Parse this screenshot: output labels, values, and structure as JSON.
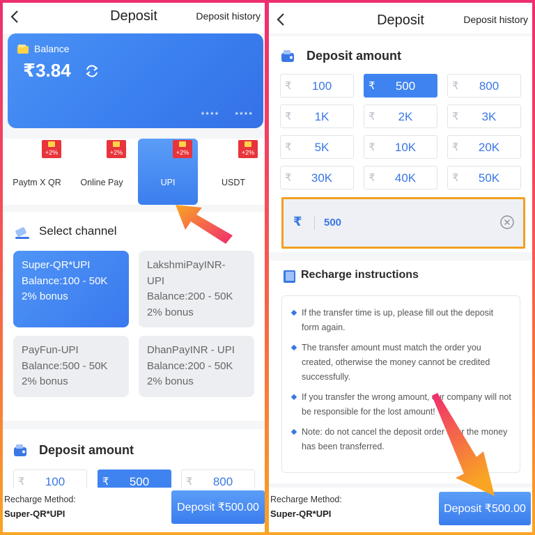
{
  "left": {
    "header": {
      "title": "Deposit",
      "history_link": "Deposit history"
    },
    "balance": {
      "label": "Balance",
      "amount": "₹3.84",
      "card_mask_1": "****",
      "card_mask_2": "****"
    },
    "pay_tabs": [
      {
        "label": "Paytm X QR",
        "bonus": "+2%"
      },
      {
        "label": "Online Pay",
        "bonus": "+2%"
      },
      {
        "label": "UPI",
        "bonus": "+2%",
        "active": true
      },
      {
        "label": "USDT",
        "bonus": "+2%"
      }
    ],
    "select_channel": {
      "title": "Select channel",
      "channels": [
        {
          "line1": "Super-QR*UPI",
          "line2": "Balance:100 - 50K",
          "line3": "2% bonus",
          "active": true
        },
        {
          "line1": "LakshmiPayINR-",
          "line1b": "UPI",
          "line2": "Balance:200 - 50K",
          "line3": "2% bonus"
        },
        {
          "line1": "PayFun-UPI",
          "line2": "Balance:500 - 50K",
          "line3": "2% bonus"
        },
        {
          "line1": "DhanPayINR - UPI",
          "line2": "Balance:200 - 50K",
          "line3": "2% bonus"
        }
      ]
    },
    "deposit_amount": {
      "title": "Deposit amount",
      "amounts": [
        {
          "cur": "₹",
          "value": "100"
        },
        {
          "cur": "₹",
          "value": "500",
          "active": true
        },
        {
          "cur": "₹",
          "value": "800"
        }
      ]
    },
    "footer": {
      "method_label": "Recharge Method:",
      "method": "Super-QR*UPI",
      "button": "Deposit ₹500.00"
    }
  },
  "right": {
    "header": {
      "title": "Deposit",
      "history_link": "Deposit history"
    },
    "deposit_amount": {
      "title": "Deposit amount",
      "currency": "₹",
      "amounts": [
        "100",
        "500",
        "800",
        "1K",
        "2K",
        "3K",
        "5K",
        "10K",
        "20K",
        "30K",
        "40K",
        "50K"
      ],
      "selected": "500",
      "input_value": "500",
      "input_rupee": "₹"
    },
    "instructions": {
      "title": "Recharge instructions",
      "items": [
        "If the transfer time is up, please fill out the deposit form again.",
        "The transfer amount must match the order you created, otherwise the money cannot be credited successfully.",
        "If you transfer the wrong amount, our company will not be responsible for the lost amount!",
        "Note: do not cancel the deposit order after the money has been transferred."
      ]
    },
    "footer": {
      "method_label": "Recharge Method:",
      "method": "Super-QR*UPI",
      "button": "Deposit ₹500.00"
    }
  },
  "colors": {
    "accent_blue": "#3f83f1",
    "highlight_orange": "#f0a020",
    "badge_red": "#e8343a",
    "arrow_pink": "#f02c70"
  },
  "icons": [
    "back-arrow-icon",
    "wallet-icon",
    "refresh-icon",
    "gift-icon",
    "channel-icon",
    "deposit-icon",
    "clear-icon",
    "book-icon"
  ]
}
